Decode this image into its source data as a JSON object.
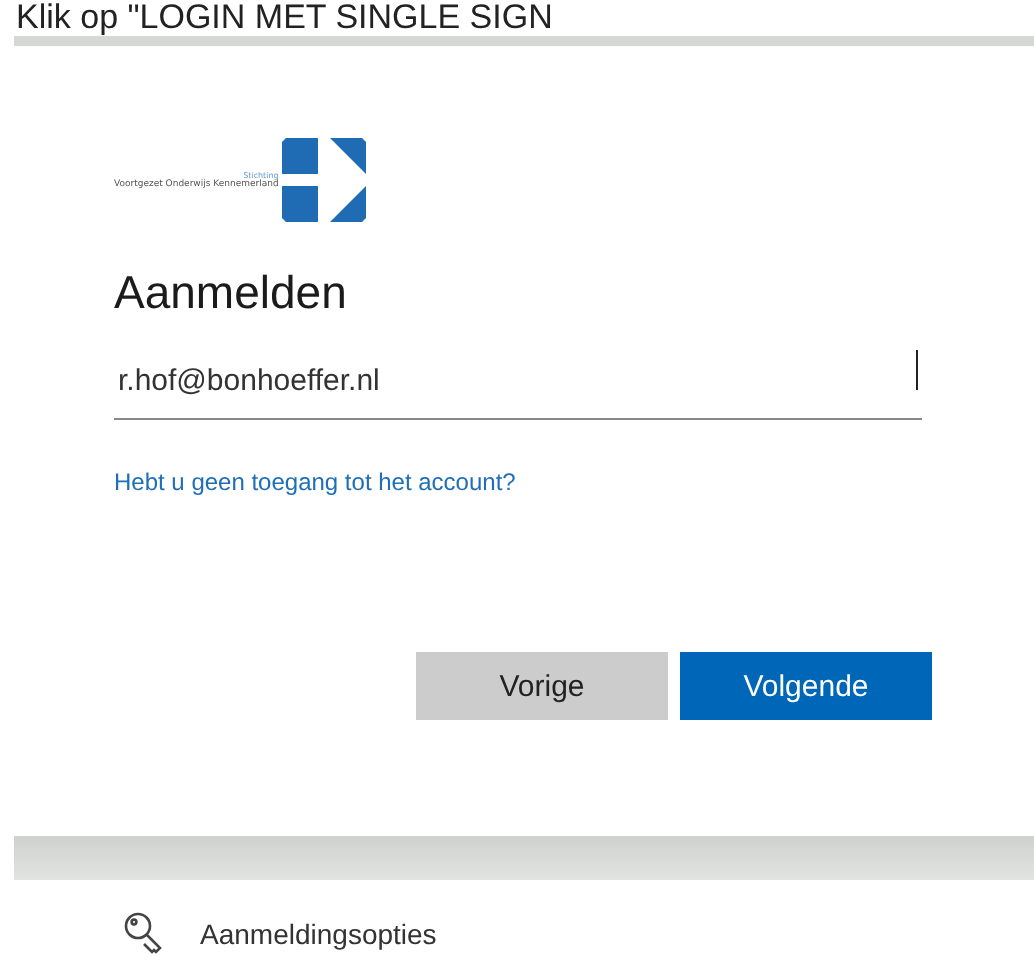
{
  "caption": "Klik op \"LOGIN MET SINGLE SIGN",
  "logo": {
    "small": "Stichting",
    "name": "Voortgezet Onderwijs Kennemerland"
  },
  "heading": "Aanmelden",
  "email_field": {
    "value": "r.hof@bonhoeffer.nl"
  },
  "help_link": "Hebt u geen toegang tot het account?",
  "buttons": [
    {
      "label": "Vorige",
      "kind": "secondary"
    },
    {
      "label": "Volgende",
      "kind": "primary"
    }
  ],
  "sign_in_options": "Aanmeldingsopties"
}
